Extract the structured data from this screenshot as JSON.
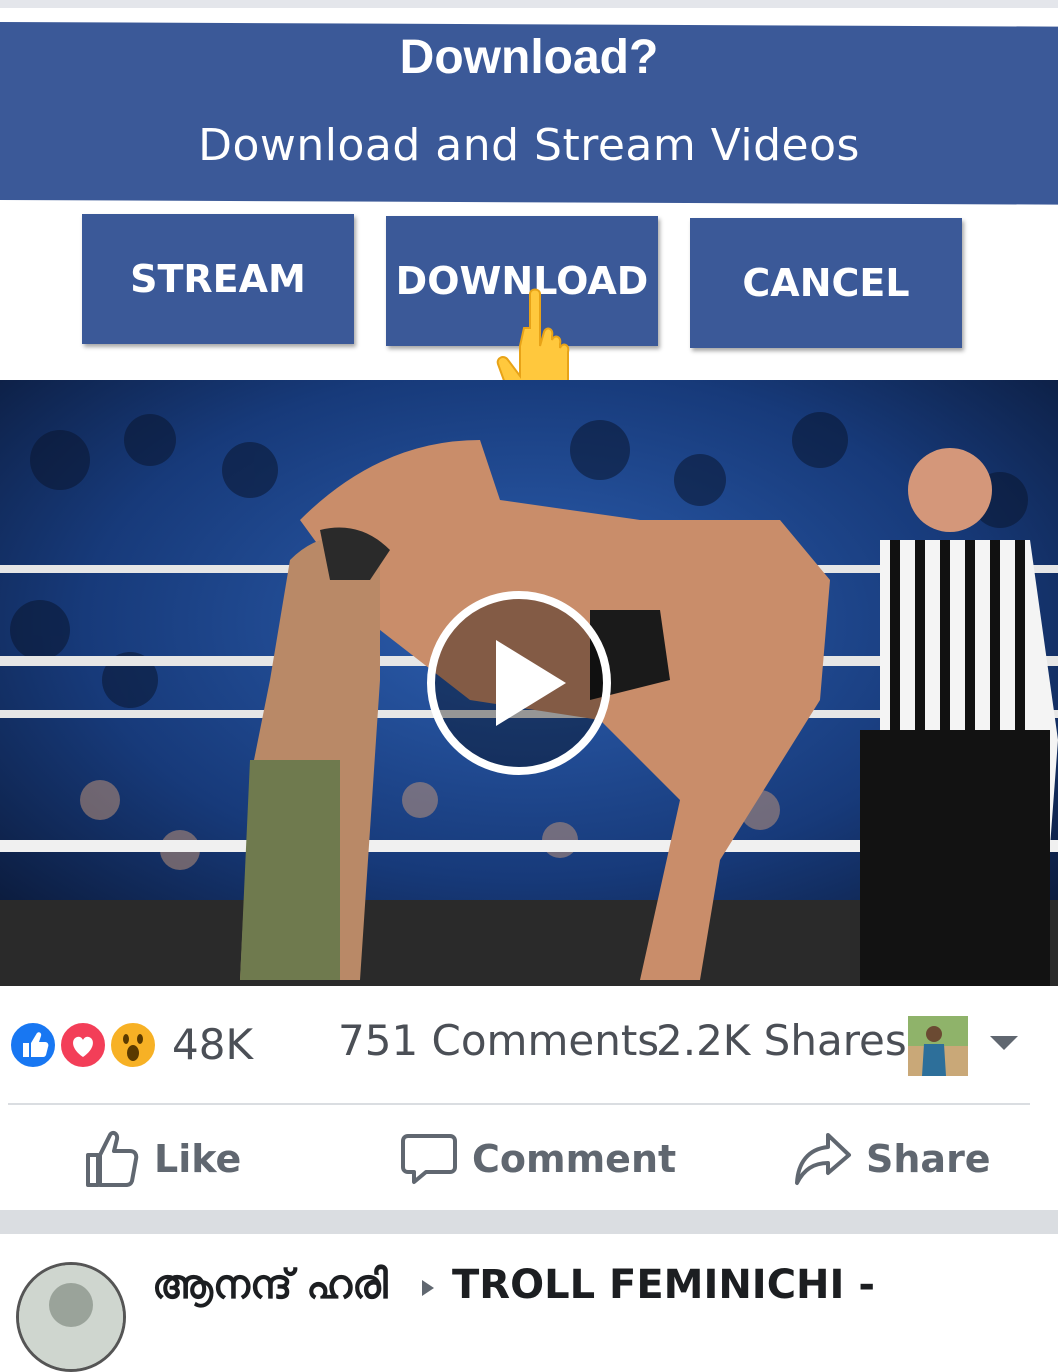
{
  "dialog": {
    "title": "Download?",
    "subtitle": "Download and Stream Videos",
    "buttons": {
      "stream": "STREAM",
      "download": "DOWNLOAD",
      "cancel": "CANCEL"
    }
  },
  "video": {
    "play_icon": "play-icon"
  },
  "stats": {
    "reactions": [
      "like",
      "love",
      "wow"
    ],
    "reaction_count": "48K",
    "comments": "751 Comments",
    "shares": "2.2K Shares"
  },
  "actions": {
    "like": "Like",
    "comment": "Comment",
    "share": "Share"
  },
  "next_post": {
    "author": "ആനന്ദ് ഹരി",
    "group": "TROLL FEMINICHI -"
  },
  "colors": {
    "facebook_blue": "#3b5998",
    "like_blue": "#1877f2",
    "love_red": "#f33e58",
    "wow_yellow": "#f7b125",
    "text_gray": "#606770"
  }
}
